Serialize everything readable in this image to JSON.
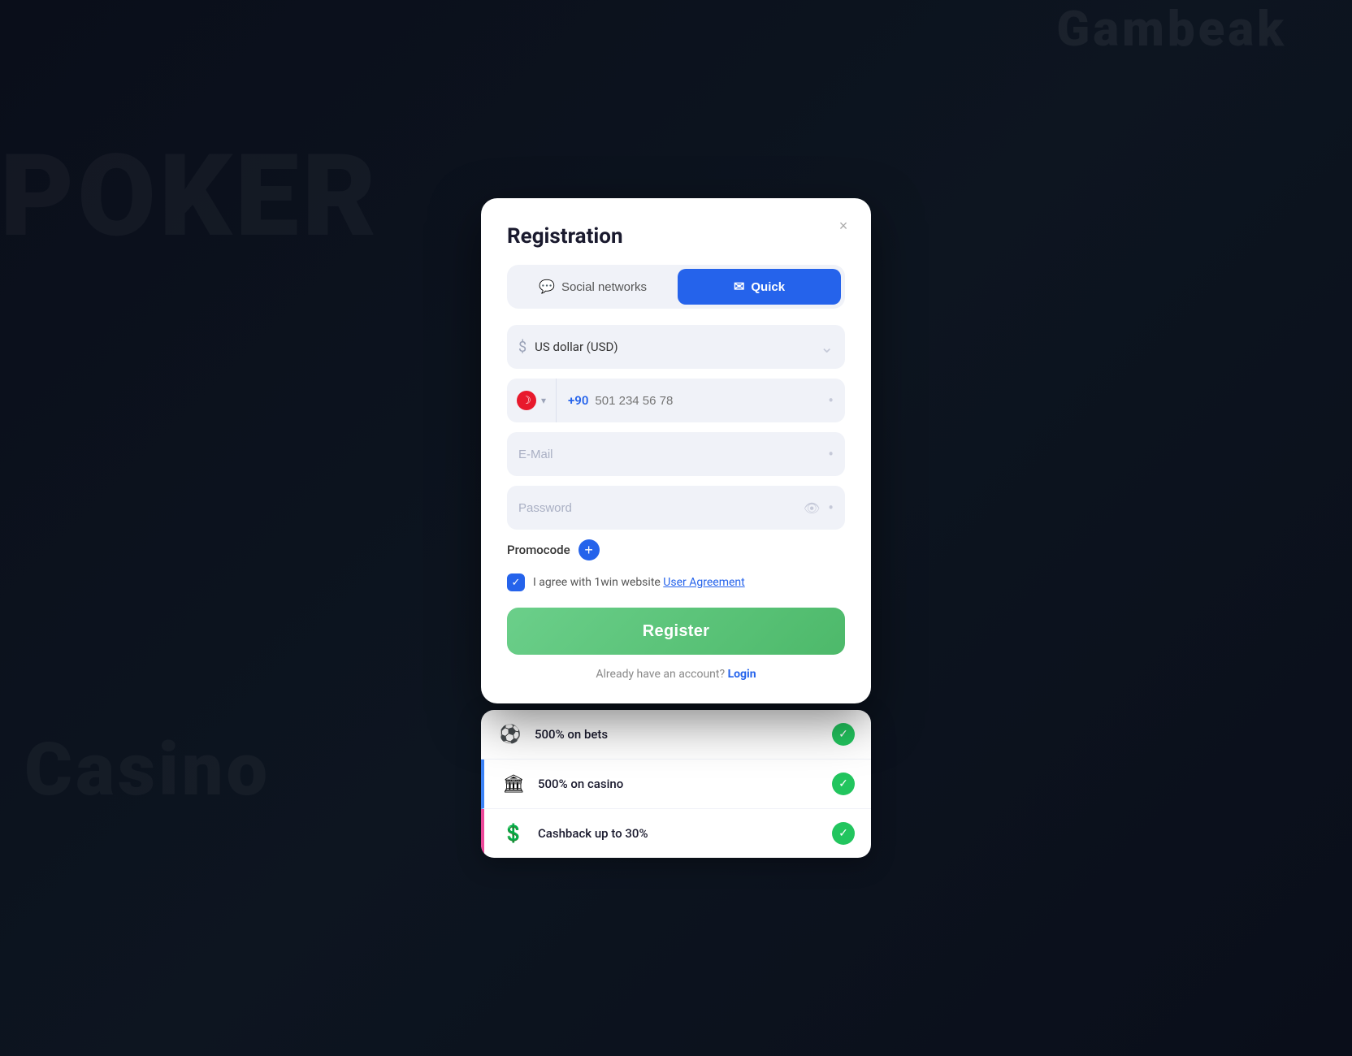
{
  "background": {
    "poker_text": "POKER",
    "casino_text": "Casino",
    "logo_text": "Gambeak"
  },
  "modal": {
    "title": "Registration",
    "close_label": "×",
    "tabs": [
      {
        "id": "social",
        "label": "Social networks",
        "icon": "💬",
        "active": false
      },
      {
        "id": "quick",
        "label": "Quick",
        "icon": "✉",
        "active": true
      }
    ],
    "currency_field": {
      "value": "US dollar (USD)",
      "placeholder": "US dollar (USD)"
    },
    "phone_field": {
      "country_code": "+90",
      "placeholder": "501 234 56 78"
    },
    "email_field": {
      "placeholder": "E-Mail"
    },
    "password_field": {
      "placeholder": "Password"
    },
    "promocode": {
      "label": "Promocode",
      "button_label": "+"
    },
    "agreement": {
      "text": "I agree with 1win website ",
      "link_text": "User Agreement"
    },
    "register_button": "Register",
    "login_prompt": "Already have an account? ",
    "login_link": "Login"
  },
  "bonus_items": [
    {
      "emoji": "⚽",
      "text": "500% on bets"
    },
    {
      "emoji": "🏛",
      "text": "500% on casino"
    },
    {
      "emoji": "💲",
      "text": "Cashback up to 30%"
    }
  ]
}
